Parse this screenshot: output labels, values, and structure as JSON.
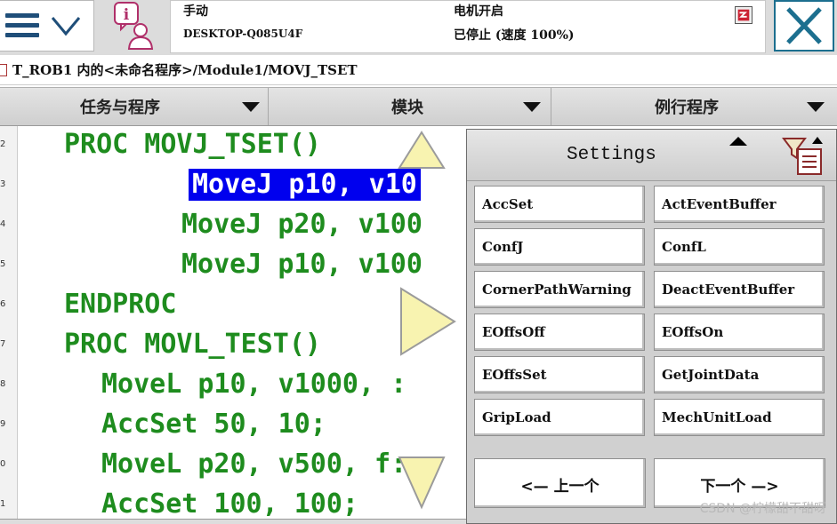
{
  "status": {
    "mode": "手动",
    "host": "DESKTOP-Q085U4F",
    "motors": "电机开启",
    "run_state": "已停止 (速度 100%)"
  },
  "breadcrumb": "T_ROB1 内的<未命名程序>/Module1/MOVJ_TSET",
  "tabs": [
    "任务与程序",
    "模块",
    "例行程序"
  ],
  "editor": {
    "line_numbers": [
      "2",
      "3",
      "4",
      "5",
      "6",
      "7",
      "8",
      "9",
      "0",
      "1"
    ],
    "lines": [
      "PROC MOVJ_TSET()",
      "MoveJ p10, v10",
      "MoveJ p20, v100",
      "MoveJ p10, v100",
      "ENDPROC",
      "PROC MOVL_TEST()",
      "MoveL p10, v1000, :",
      "AccSet 50, 10;",
      "MoveL p20, v500, f:",
      "AccSet 100, 100;"
    ],
    "selected_line_index": 1
  },
  "popup": {
    "title": "Settings",
    "instructions": [
      "AccSet",
      "ActEventBuffer",
      "ConfJ",
      "ConfL",
      "CornerPathWarning",
      "DeactEventBuffer",
      "EOffsOff",
      "EOffsOn",
      "EOffsSet",
      "GetJointData",
      "GripLoad",
      "MechUnitLoad"
    ],
    "prev_label": "<—  上一个",
    "next_label": "下一个  —>"
  },
  "watermark": "CSDN @柠檬甜不甜呀",
  "icons": {
    "menu": "hamburger-menu-icon",
    "user": "operator-info-icon",
    "close": "close-x-icon",
    "filter": "filter-list-icon"
  },
  "colors": {
    "code_green": "#1e8c1e",
    "selection_blue": "#0000ee",
    "close_teal": "#1c6f8f",
    "nav_arrow_fill": "#f8f3b0"
  }
}
